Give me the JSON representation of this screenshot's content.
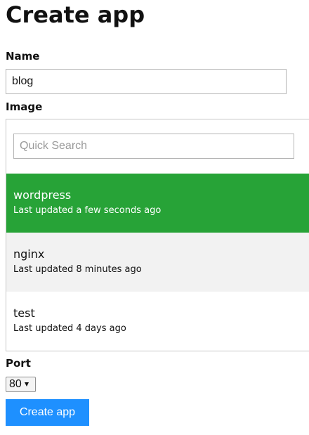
{
  "page": {
    "title": "Create app"
  },
  "form": {
    "name_label": "Name",
    "name_value": "blog",
    "image_label": "Image",
    "search_placeholder": "Quick Search",
    "images": [
      {
        "name": "wordpress",
        "updated": "Last updated a few seconds ago",
        "selected": true
      },
      {
        "name": "nginx",
        "updated": "Last updated 8 minutes ago",
        "selected": false
      },
      {
        "name": "test",
        "updated": "Last updated 4 days ago",
        "selected": false
      }
    ],
    "port_label": "Port",
    "port_value": "80",
    "submit_label": "Create app"
  },
  "colors": {
    "selected_item": "#27a337",
    "alt_item": "#f2f2f2",
    "primary_button": "#1e90ff"
  }
}
